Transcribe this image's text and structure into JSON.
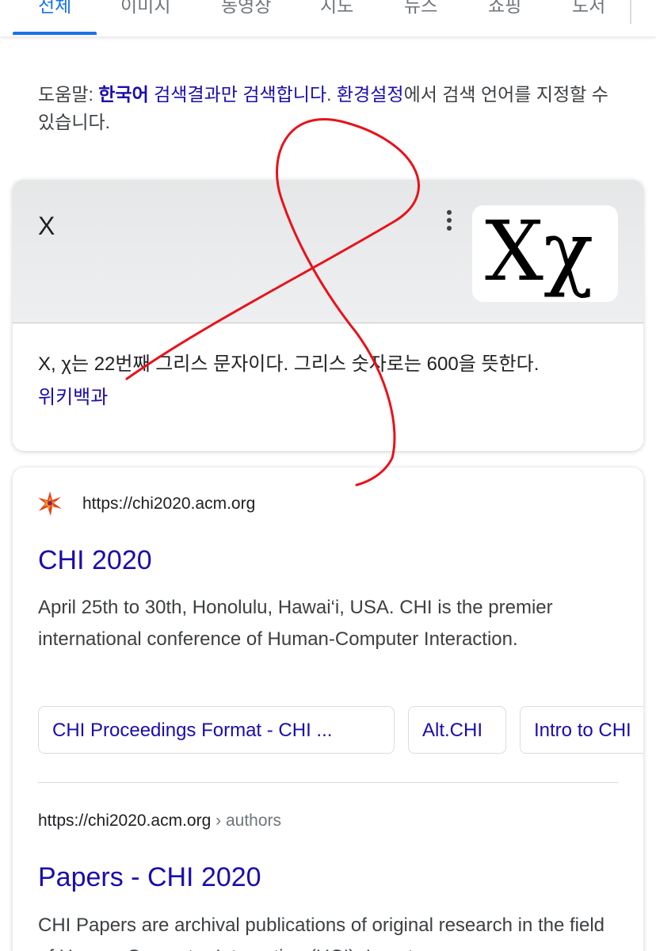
{
  "tabs": [
    {
      "label": "전체",
      "active": true
    },
    {
      "label": "이미지"
    },
    {
      "label": "동영상"
    },
    {
      "label": "지도"
    },
    {
      "label": "뉴스"
    },
    {
      "label": "쇼핑"
    },
    {
      "label": "도서"
    }
  ],
  "help": {
    "prefix": "도움말: ",
    "lang": "한국어",
    "link1": " 검색결과만 검색합니다",
    "period": ". ",
    "link2": "환경설정",
    "suffix": "에서 검색 언어를 지정할 수 있습니다."
  },
  "knowledge_card": {
    "title": "X",
    "image_text": "Xχ",
    "description": "X, χ는 22번째 그리스 문자이다. 그리스 숫자로는 600을 뜻한다.",
    "source": "위키백과",
    "more_icon": "more-vert-icon"
  },
  "result1": {
    "favicon": "chi-flower-icon",
    "url": "https://chi2020.acm.org",
    "title": "CHI 2020",
    "snippet": "April 25th to 30th, Honolulu, Hawai‘i, USA. CHI is the premier international conference of Human-Computer Interaction.",
    "chips": [
      "CHI Proceedings Format - CHI ...",
      "Alt.CHI",
      "Intro to CHI"
    ]
  },
  "result2": {
    "url": "https://chi2020.acm.org",
    "breadcrumb": " › authors",
    "title": "Papers - CHI 2020",
    "snippet": "CHI Papers are archival publications of original research in the field of Human-Computer Interaction (HCI). In ent"
  },
  "colors": {
    "accent": "#1a73e8",
    "link": "#1a0dab",
    "scribble": "#e8121a"
  }
}
